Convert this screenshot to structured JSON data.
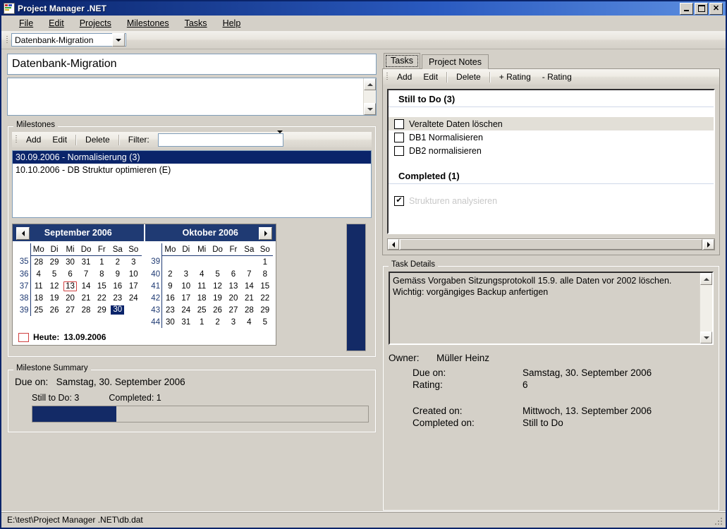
{
  "window": {
    "title": "Project Manager .NET",
    "icon": "app-icon",
    "minimize": "_",
    "maximize": "□",
    "close": "✕"
  },
  "menu": [
    {
      "label": "File"
    },
    {
      "label": "Edit"
    },
    {
      "label": "Projects"
    },
    {
      "label": "Milestones"
    },
    {
      "label": "Tasks"
    },
    {
      "label": "Help"
    }
  ],
  "project_selector": {
    "value": "Datenbank-Migration"
  },
  "project": {
    "name": "Datenbank-Migration",
    "description": ""
  },
  "milestones": {
    "legend": "Milestones",
    "toolbar": {
      "add": "Add",
      "edit": "Edit",
      "delete": "Delete",
      "filter_label": "Filter:",
      "filter_value": ""
    },
    "items": [
      {
        "text": "30.09.2006 - Normalisierung (3)",
        "selected": true
      },
      {
        "text": "10.10.2006 - DB Struktur optimieren (E)",
        "selected": false
      }
    ]
  },
  "calendar": {
    "prev_arrow": "◀",
    "next_arrow": "▶",
    "weekday_headers": [
      "Mo",
      "Di",
      "Mi",
      "Do",
      "Fr",
      "Sa",
      "So"
    ],
    "today_label": "Heute:",
    "today_date": "13.09.2006",
    "months": [
      {
        "title": "September 2006",
        "weeks": [
          {
            "week": "35",
            "days": [
              {
                "d": "28",
                "other": true
              },
              {
                "d": "29",
                "other": true
              },
              {
                "d": "30",
                "other": true
              },
              {
                "d": "31",
                "other": true
              },
              {
                "d": "1"
              },
              {
                "d": "2"
              },
              {
                "d": "3"
              }
            ]
          },
          {
            "week": "36",
            "days": [
              {
                "d": "4"
              },
              {
                "d": "5"
              },
              {
                "d": "6"
              },
              {
                "d": "7"
              },
              {
                "d": "8"
              },
              {
                "d": "9"
              },
              {
                "d": "10"
              }
            ]
          },
          {
            "week": "37",
            "days": [
              {
                "d": "11"
              },
              {
                "d": "12"
              },
              {
                "d": "13",
                "today": true
              },
              {
                "d": "14"
              },
              {
                "d": "15"
              },
              {
                "d": "16"
              },
              {
                "d": "17"
              }
            ]
          },
          {
            "week": "38",
            "days": [
              {
                "d": "18"
              },
              {
                "d": "19"
              },
              {
                "d": "20"
              },
              {
                "d": "21"
              },
              {
                "d": "22"
              },
              {
                "d": "23"
              },
              {
                "d": "24"
              }
            ]
          },
          {
            "week": "39",
            "days": [
              {
                "d": "25"
              },
              {
                "d": "26"
              },
              {
                "d": "27"
              },
              {
                "d": "28"
              },
              {
                "d": "29"
              },
              {
                "d": "30",
                "selected": true
              },
              {
                "d": ""
              }
            ]
          }
        ]
      },
      {
        "title": "Oktober 2006",
        "weeks": [
          {
            "week": "39",
            "days": [
              {
                "d": ""
              },
              {
                "d": ""
              },
              {
                "d": ""
              },
              {
                "d": ""
              },
              {
                "d": ""
              },
              {
                "d": ""
              },
              {
                "d": "1"
              }
            ]
          },
          {
            "week": "40",
            "days": [
              {
                "d": "2"
              },
              {
                "d": "3"
              },
              {
                "d": "4"
              },
              {
                "d": "5"
              },
              {
                "d": "6"
              },
              {
                "d": "7"
              },
              {
                "d": "8"
              }
            ]
          },
          {
            "week": "41",
            "days": [
              {
                "d": "9"
              },
              {
                "d": "10",
                "bold": true
              },
              {
                "d": "11"
              },
              {
                "d": "12"
              },
              {
                "d": "13"
              },
              {
                "d": "14"
              },
              {
                "d": "15"
              }
            ]
          },
          {
            "week": "42",
            "days": [
              {
                "d": "16"
              },
              {
                "d": "17"
              },
              {
                "d": "18"
              },
              {
                "d": "19"
              },
              {
                "d": "20"
              },
              {
                "d": "21"
              },
              {
                "d": "22"
              }
            ]
          },
          {
            "week": "43",
            "days": [
              {
                "d": "23"
              },
              {
                "d": "24"
              },
              {
                "d": "25"
              },
              {
                "d": "26"
              },
              {
                "d": "27"
              },
              {
                "d": "28"
              },
              {
                "d": "29"
              }
            ]
          },
          {
            "week": "44",
            "days": [
              {
                "d": "30"
              },
              {
                "d": "31"
              },
              {
                "d": "1",
                "other": true
              },
              {
                "d": "2",
                "other": true
              },
              {
                "d": "3",
                "other": true
              },
              {
                "d": "4",
                "other": true
              },
              {
                "d": "5",
                "other": true
              }
            ]
          }
        ]
      }
    ]
  },
  "milestone_summary": {
    "legend": "Milestone Summary",
    "due_label": "Due on:",
    "due_value": "Samstag, 30. September 2006",
    "still_to_do": "Still to Do: 3",
    "completed": "Completed: 1",
    "progress_percent": 25
  },
  "tabs": [
    {
      "label": "Tasks",
      "active": true
    },
    {
      "label": "Project Notes",
      "active": false
    }
  ],
  "tasks": {
    "toolbar": {
      "add": "Add",
      "edit": "Edit",
      "delete": "Delete",
      "plus_rating": "+ Rating",
      "minus_rating": "- Rating"
    },
    "sections": [
      {
        "header": "Still to Do (3)",
        "items": [
          {
            "label": "Veraltete Daten löschen",
            "checked": false,
            "highlighted": true
          },
          {
            "label": "DB1 Normalisieren",
            "checked": false,
            "highlighted": false
          },
          {
            "label": "DB2 normalisieren",
            "checked": false,
            "highlighted": false
          }
        ]
      },
      {
        "header": "Completed (1)",
        "items": [
          {
            "label": "Strukturen analysieren",
            "checked": true,
            "highlighted": false,
            "done": true
          }
        ]
      }
    ]
  },
  "task_details": {
    "legend": "Task Details",
    "notes": "Gemäss Vorgaben Sitzungsprotokoll 15.9. alle Daten vor 2002 löschen. Wichtig: vorgängiges Backup anfertigen",
    "owner_label": "Owner:",
    "owner_value": "Müller Heinz",
    "due_label": "Due on:",
    "due_value": "Samstag, 30. September 2006",
    "rating_label": "Rating:",
    "rating_value": "6",
    "created_label": "Created on:",
    "created_value": "Mittwoch, 13. September 2006",
    "completed_label": "Completed on:",
    "completed_value": "Still to Do"
  },
  "statusbar": {
    "path": "E:\\test\\Project Manager .NET\\db.dat"
  },
  "colors": {
    "titlebar_start": "#0a246a",
    "selection": "#0a246a",
    "calendar_header": "#1f3a73",
    "progress_fill": "#132a66",
    "today_outline": "#d04040",
    "face": "#d4d0c8"
  }
}
